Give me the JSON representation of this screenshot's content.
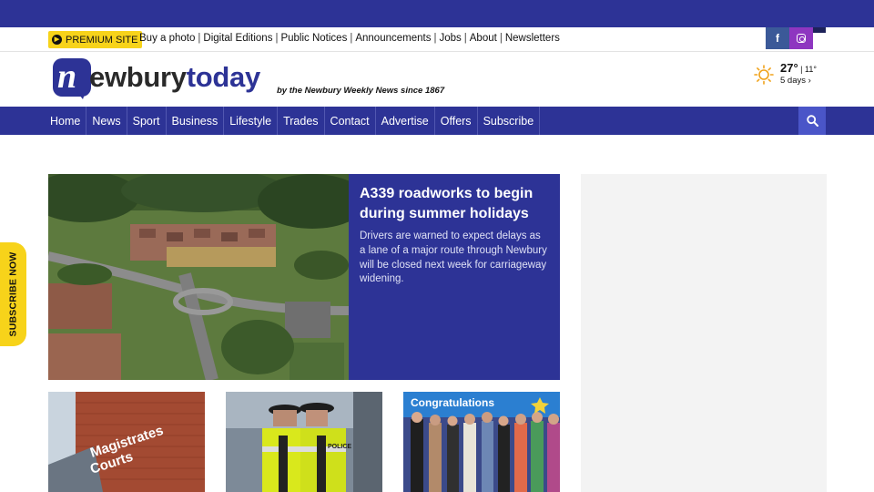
{
  "site": {
    "premium_label": "PREMIUM SITE",
    "top_links": [
      "Buy a photo",
      "Digital Editions",
      "Public Notices",
      "Announcements",
      "Jobs",
      "About",
      "Newsletters"
    ],
    "social": [
      {
        "name": "facebook",
        "glyph": "f"
      },
      {
        "name": "instagram",
        "glyph": ""
      }
    ],
    "logo": {
      "prefix": "n",
      "word_main": "ewbury",
      "word_accent": "today"
    },
    "tagline": "by the Newbury Weekly News since 1867"
  },
  "weather": {
    "icon": "sun-icon",
    "high": "27°",
    "separator": " | ",
    "low": "11°",
    "forecast_link": "5 days ›"
  },
  "nav": {
    "items": [
      "Home",
      "News",
      "Sport",
      "Business",
      "Lifestyle",
      "Trades",
      "Contact",
      "Advertise",
      "Offers",
      "Subscribe"
    ],
    "search_icon": "search-icon"
  },
  "subscribe_tab": "SUBSCRIBE NOW",
  "lead_story": {
    "title": "A339 roadworks to begin during summer holidays",
    "summary": "Drivers are warned to expect delays as a lane of a major route through Newbury will be closed next week for carriageway widening.",
    "image": "aerial view of Newbury roundabout and housing"
  },
  "cards": [
    {
      "image": "magistrates court building sign",
      "sign_text": [
        "Magistrates",
        "Courts"
      ]
    },
    {
      "image": "two police officers in hi-vis vests",
      "badge_text": "POLICE"
    },
    {
      "image": "group photo under congratulations banner",
      "banner_text": "Congratulations"
    }
  ],
  "colors": {
    "brand_blue": "#2d3396",
    "accent_yellow": "#f7d31a",
    "ad_panel": "#f3f3f3"
  }
}
